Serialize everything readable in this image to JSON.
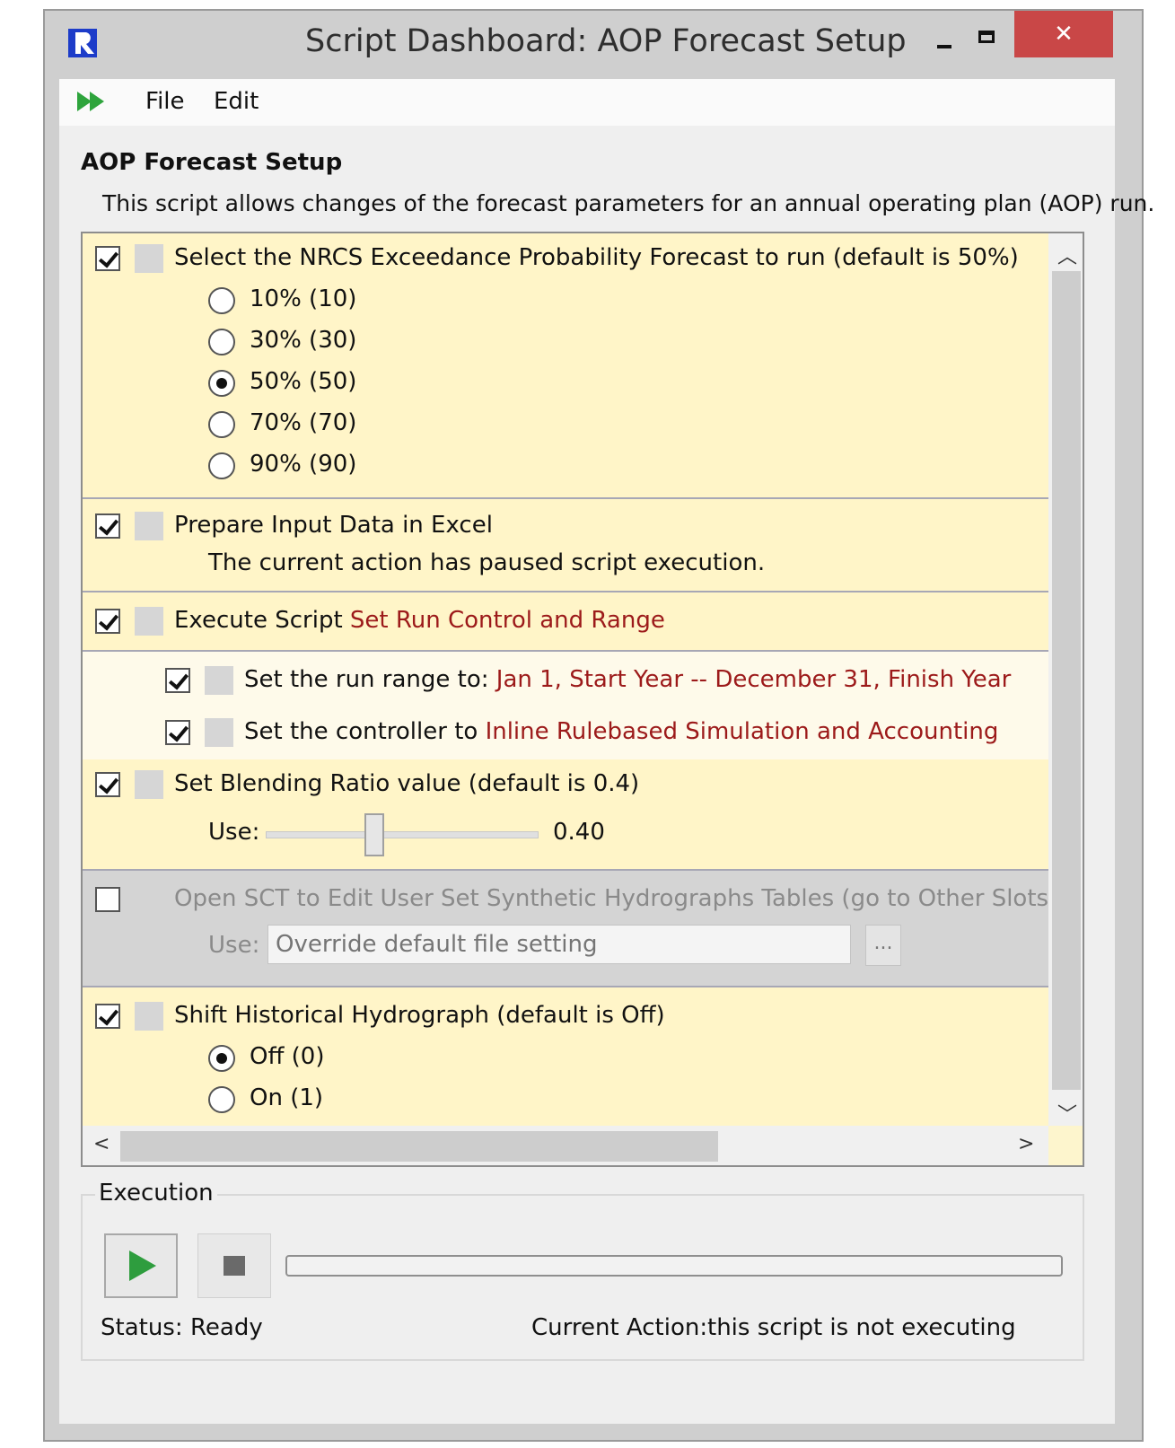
{
  "window": {
    "title": "Script Dashboard: AOP Forecast Setup",
    "close_label": "✕"
  },
  "menu": {
    "file": "File",
    "edit": "Edit"
  },
  "heading": "AOP Forecast Setup",
  "description": "This script allows changes of the forecast parameters for an annual operating plan (AOP) run.",
  "actions": {
    "forecast": {
      "checked": true,
      "label": "Select the NRCS Exceedance Probability Forecast to run (default is  50%)",
      "options": [
        "10% (10)",
        "30% (30)",
        "50% (50)",
        "70% (70)",
        "90% (90)"
      ],
      "selected": "50% (50)"
    },
    "prepare": {
      "checked": true,
      "label": "Prepare Input Data in Excel",
      "note": "The current action has paused script execution."
    },
    "execute": {
      "checked": true,
      "label": "Execute Script ",
      "script_name": "Set Run Control and Range"
    },
    "run_range": {
      "checked": true,
      "label": "Set the run range to: ",
      "value": "Jan 1, Start Year -- December 31, Finish Year"
    },
    "controller": {
      "checked": true,
      "label": "Set the controller to ",
      "value": "Inline Rulebased Simulation and Accounting"
    },
    "blending": {
      "checked": true,
      "label": "Set Blending Ratio value (default is 0.4)",
      "use_label": "Use:",
      "value": "0.40",
      "slider_fraction": 0.4
    },
    "sct": {
      "checked": false,
      "label": "Open SCT to Edit User Set Synthetic Hydrographs Tables (go to Other Slots tab, highlight",
      "use_label": "Use:",
      "placeholder": "Override default file setting",
      "browse_label": "..."
    },
    "shift": {
      "checked": true,
      "label": "Shift Historical Hydrograph (default is Off)",
      "options": [
        "Off (0)",
        "On (1)"
      ],
      "selected": "Off (0)"
    }
  },
  "execution": {
    "title": "Execution",
    "status_label": "Status:",
    "status_value": "Ready",
    "current_action_label": "Current Action:",
    "current_action_value": "this script is not executing",
    "progress": 0
  },
  "colors": {
    "close": "#c94747",
    "highlight": "#fff5c8",
    "link_red": "#9c1a1a",
    "play": "#2e9d3e"
  }
}
